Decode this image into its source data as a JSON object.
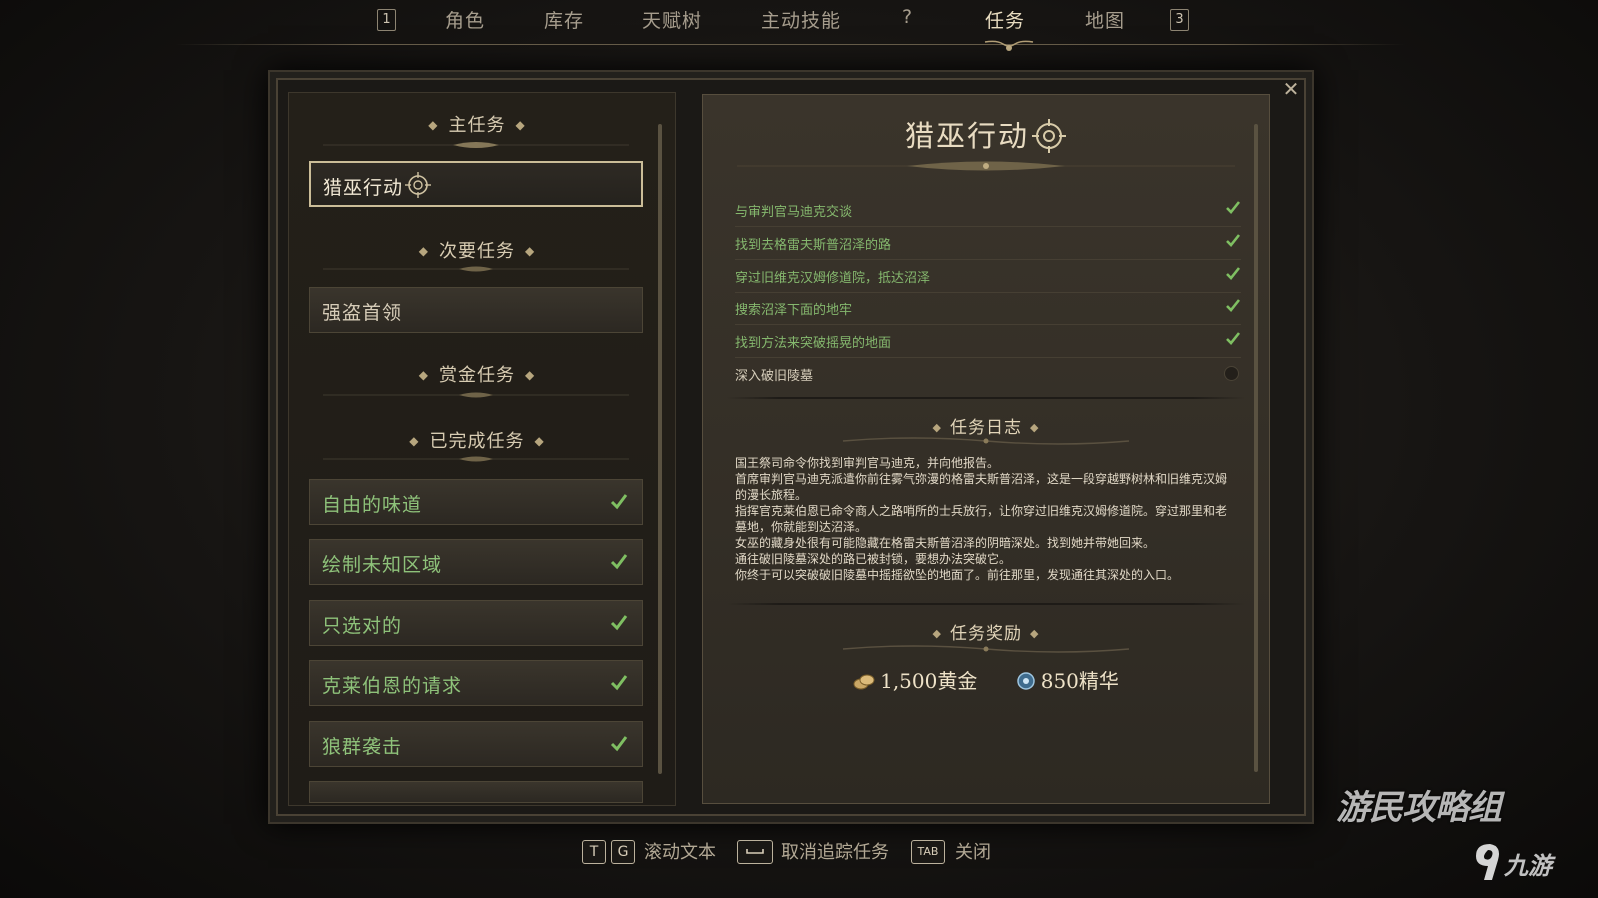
{
  "nav": {
    "key_left": "1",
    "key_right": "3",
    "tabs": [
      {
        "label": "角色",
        "active": false
      },
      {
        "label": "库存",
        "active": false
      },
      {
        "label": "天赋树",
        "active": false
      },
      {
        "label": "主动技能",
        "active": false
      },
      {
        "label": "?",
        "active": false
      },
      {
        "label": "任务",
        "active": true
      },
      {
        "label": "地图",
        "active": false
      }
    ]
  },
  "quest_list": {
    "main_header": "主任务",
    "main_quests": [
      {
        "label": "猎巫行动",
        "selected": true
      }
    ],
    "side_header": "次要任务",
    "side_quests": [
      {
        "label": "强盗首领"
      }
    ],
    "bounty_header": "赏金任务",
    "completed_header": "已完成任务",
    "completed_quests": [
      {
        "label": "自由的味道"
      },
      {
        "label": "绘制未知区域"
      },
      {
        "label": "只选对的"
      },
      {
        "label": "克莱伯恩的请求"
      },
      {
        "label": "狼群袭击"
      }
    ]
  },
  "quest_detail": {
    "title": "猎巫行动",
    "objectives": [
      {
        "text": "与审判官马迪克交谈",
        "done": true
      },
      {
        "text": "找到去格雷夫斯普沼泽的路",
        "done": true
      },
      {
        "text": "穿过旧维克汉姆修道院，抵达沼泽",
        "done": true
      },
      {
        "text": "搜索沼泽下面的地牢",
        "done": true
      },
      {
        "text": "找到方法来突破摇晃的地面",
        "done": true
      },
      {
        "text": "深入破旧陵墓",
        "done": false
      }
    ],
    "journal_header": "任务日志",
    "journal": [
      "国王祭司命令你找到审判官马迪克，并向他报告。",
      "首席审判官马迪克派遣你前往雾气弥漫的格雷夫斯普沼泽，这是一段穿越野树林和旧维克汉姆的漫长旅程。",
      "指挥官克莱伯恩已命令商人之路哨所的士兵放行，让你穿过旧维克汉姆修道院。穿过那里和老墓地，你就能到达沼泽。",
      "女巫的藏身处很有可能隐藏在格雷夫斯普沼泽的阴暗深处。找到她并带她回来。",
      "通往破旧陵墓深处的路已被封锁，要想办法突破它。",
      "你终于可以突破破旧陵墓中摇摇欲坠的地面了。前往那里，发现通往其深处的入口。"
    ],
    "rewards_header": "任务奖励",
    "rewards": [
      {
        "icon": "gold-coins-icon",
        "text": "1,500黄金"
      },
      {
        "icon": "essence-icon",
        "text": "850精华"
      }
    ]
  },
  "hints": {
    "key_t": "T",
    "key_g": "G",
    "scroll_text": "滚动文本",
    "untrack": "取消追踪任务",
    "key_tab": "TAB",
    "close": "关闭"
  },
  "watermark": {
    "main": "游民攻略组",
    "sub": "九游"
  },
  "colors": {
    "completed_green": "#8ec27a",
    "title_text": "#e9dcc2",
    "panel_bg": "#3a342b"
  }
}
